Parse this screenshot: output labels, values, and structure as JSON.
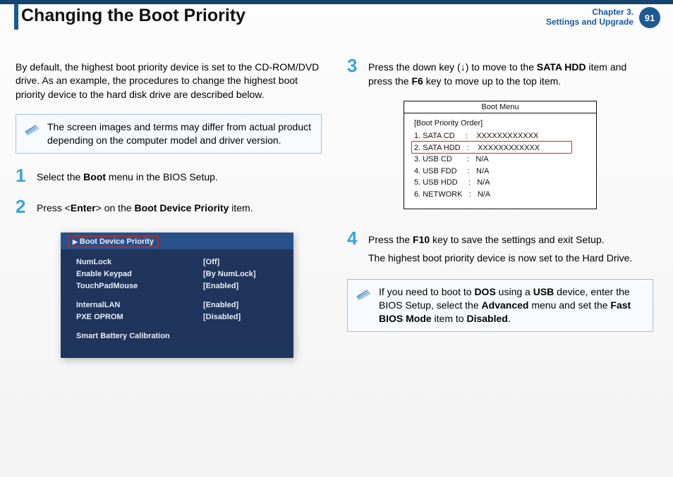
{
  "header": {
    "title": "Changing the Boot Priority",
    "chapter_line1": "Chapter 3.",
    "chapter_line2": "Settings and Upgrade",
    "page_number": "91"
  },
  "left": {
    "intro": "By default, the highest boot priority device is set to the CD-ROM/DVD drive. As an example, the procedures to change the highest boot priority device to the hard disk drive are described below.",
    "note": "The screen images and terms may differ from actual product depending on the computer model and driver version.",
    "step1_pre": "Select the ",
    "step1_bold": "Boot",
    "step1_post": " menu in the BIOS Setup.",
    "step2_a": "Press <",
    "step2_b": "Enter",
    "step2_c": "> on the ",
    "step2_d": "Boot Device Priority",
    "step2_e": " item."
  },
  "bios": {
    "highlight_label": "Boot Device Priority",
    "rows": [
      {
        "k": "NumLock",
        "v": "[Off]"
      },
      {
        "k": "Enable Keypad",
        "v": "[By NumLock]"
      },
      {
        "k": "TouchPadMouse",
        "v": "[Enabled]"
      }
    ],
    "rows2": [
      {
        "k": "InternalLAN",
        "v": "[Enabled]"
      },
      {
        "k": "PXE OPROM",
        "v": "[Disabled]"
      }
    ],
    "last": "Smart Battery Calibration"
  },
  "right": {
    "step3_a": "Press the down key (↓) to move to the ",
    "step3_b": "SATA HDD",
    "step3_c": " item and press the ",
    "step3_d": "F6",
    "step3_e": " key to move up to the top item.",
    "step4_a": "Press the ",
    "step4_b": "F10",
    "step4_c": " key to save the settings and exit Setup.",
    "step4_line2": "The highest boot priority device is now set to the Hard Drive.",
    "note_a": "If you need to boot to ",
    "note_b": "DOS",
    "note_c": " using a ",
    "note_d": "USB",
    "note_e": " device, enter the BIOS Setup, select the ",
    "note_f": "Advanced",
    "note_g": " menu and set the ",
    "note_h": "Fast BIOS Mode",
    "note_i": " item to ",
    "note_j": "Disabled",
    "note_k": "."
  },
  "boot_menu": {
    "title": "Boot Menu",
    "subtitle": "[Boot Priority Order]",
    "items": [
      "1. SATA CD     :    XXXXXXXXXXXX",
      "2. SATA HDD   :    XXXXXXXXXXXX",
      "3. USB CD       :   N/A",
      "4. USB FDD     :   N/A",
      "5. USB HDD     :   N/A",
      "6. NETWORK   :   N/A"
    ],
    "highlight_index": 1
  }
}
